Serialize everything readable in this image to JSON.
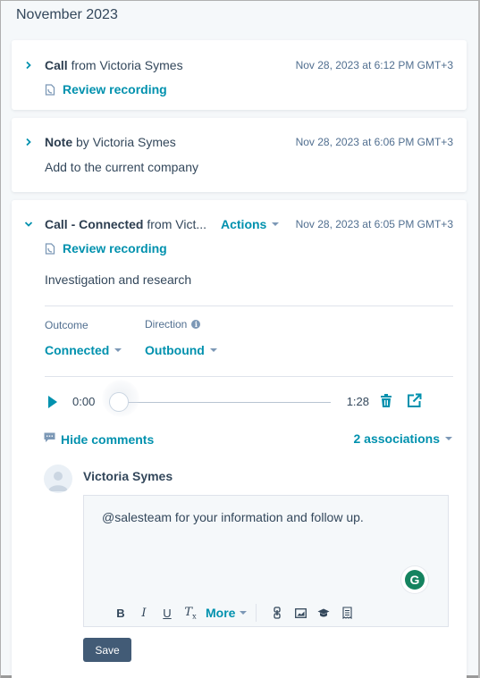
{
  "month_header": "November 2023",
  "colors": {
    "accent": "#0091ae",
    "text_primary": "#33475b",
    "text_secondary": "#516f90",
    "save_button": "#425b76",
    "grammarly": "#15835f"
  },
  "activities": [
    {
      "type": "Call",
      "connector": " from Victoria Symes",
      "date": "Nov 28, 2023 at 6:12 PM GMT+3",
      "expanded": false,
      "link_label": "Review recording",
      "icon": "chevron-right-icon"
    },
    {
      "type": "Note",
      "connector": " by Victoria Symes",
      "date": "Nov 28, 2023 at 6:06 PM GMT+3",
      "expanded": false,
      "body": "Add to the current company",
      "icon": "chevron-right-icon"
    },
    {
      "type": "Call - Connected",
      "connector": " from Vict...",
      "actions_label": "Actions",
      "date": "Nov 28, 2023 at 6:05 PM GMT+3",
      "expanded": true,
      "link_label": "Review recording",
      "body": "Investigation and research",
      "icon": "chevron-down-icon",
      "outcome": {
        "label": "Outcome",
        "value": "Connected"
      },
      "direction": {
        "label": "Direction",
        "value": "Outbound",
        "info_icon": "info-icon"
      },
      "player": {
        "current_time": "0:00",
        "duration": "1:28",
        "progress": 0
      },
      "hide_comments_label": "Hide comments",
      "associations_label": "2 associations",
      "comment": {
        "author": "Victoria Symes",
        "text": "@salesteam for your information and follow up.",
        "toolbar": {
          "bold": "B",
          "italic": "I",
          "underline": "U",
          "clear_format": "T",
          "more": "More"
        },
        "save_label": "Save"
      }
    }
  ]
}
